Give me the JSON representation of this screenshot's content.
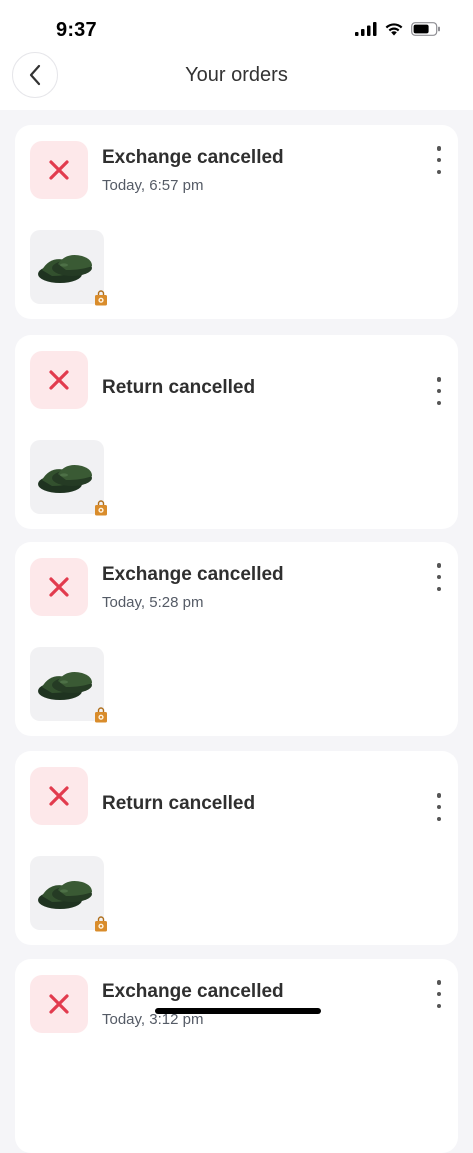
{
  "status_bar": {
    "time": "9:37",
    "icons": [
      "cellular-signal-icon",
      "wifi-icon",
      "battery-icon"
    ]
  },
  "nav": {
    "title": "Your orders",
    "back_icon": "chevron-left-icon"
  },
  "colors": {
    "cancel_red": "#e23b4e",
    "cancel_bg": "#fde8ea",
    "product_green": "#2f4a2a",
    "badge_orange": "#d98c2b"
  },
  "orders": [
    {
      "title": "Exchange cancelled",
      "time": "Today, 6:57 pm",
      "status_icon": "x-icon",
      "product": "green-slide-sandals"
    },
    {
      "title": "Return cancelled",
      "time": "",
      "status_icon": "x-icon",
      "product": "green-slide-sandals"
    },
    {
      "title": "Exchange cancelled",
      "time": "Today, 5:28 pm",
      "status_icon": "x-icon",
      "product": "green-slide-sandals"
    },
    {
      "title": "Return cancelled",
      "time": "",
      "status_icon": "x-icon",
      "product": "green-slide-sandals"
    },
    {
      "title": "Exchange cancelled",
      "time": "Today, 3:12 pm",
      "status_icon": "x-icon",
      "product": "green-slide-sandals"
    }
  ]
}
